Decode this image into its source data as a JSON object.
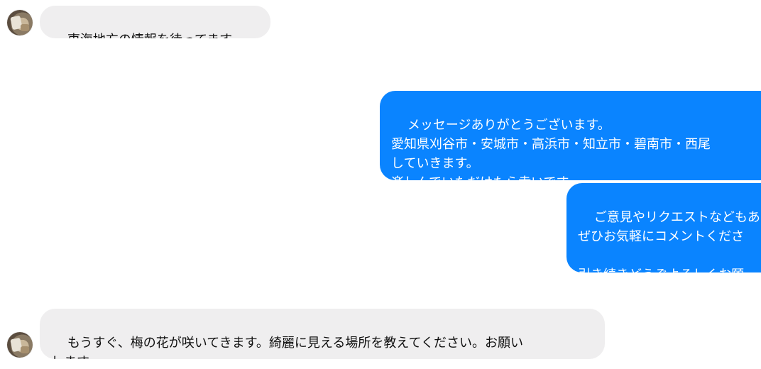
{
  "messages": [
    {
      "direction": "incoming",
      "text": "東海地方の情報を待ってます。"
    },
    {
      "direction": "outgoing",
      "text": "メッセージありがとうございます。\n愛知県刈谷市・安城市・高浜市・知立市・碧南市・西尾\nしていきます。\n楽しんでいただけたら幸いです。"
    },
    {
      "direction": "outgoing",
      "text": "ご意見やリクエストなどもあ\nぜひお気軽にコメントくださ\n\n引き続きどうぞよろしくお願"
    },
    {
      "direction": "incoming",
      "text": "もうすぐ、梅の花が咲いてきます。綺麗に見える場所を教えてください。お願い\nします。"
    }
  ],
  "colors": {
    "incoming_bubble": "#efeeef",
    "outgoing_bubble": "#0a84ff",
    "outgoing_text": "#ffffff",
    "incoming_text": "#111111"
  },
  "icons": {
    "sender_avatar": "avatar-photo"
  }
}
